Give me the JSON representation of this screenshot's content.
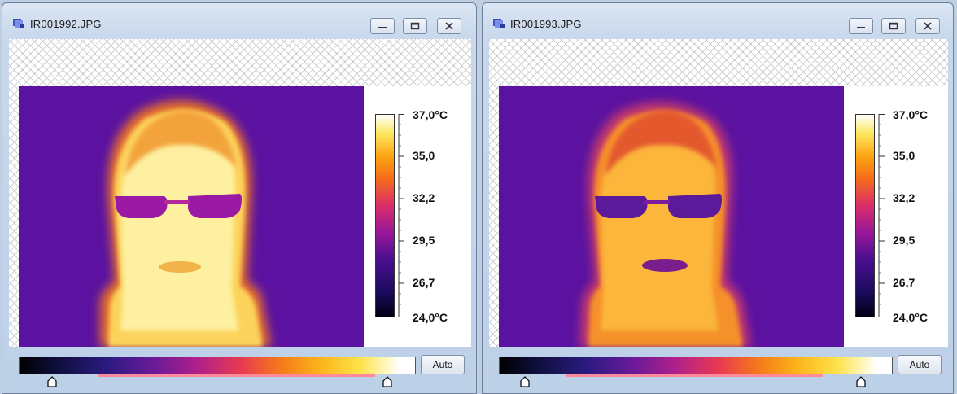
{
  "windows": [
    {
      "title": "IR001992.JPG",
      "scale": {
        "max_label": "37,0°C",
        "min_label": "24,0°C",
        "mid_labels": [
          "35,0",
          "32,2",
          "29,5",
          "26,7"
        ]
      },
      "auto_label": "Auto"
    },
    {
      "title": "IR001993.JPG",
      "scale": {
        "max_label": "37,0°C",
        "min_label": "24,0°C",
        "mid_labels": [
          "35,0",
          "32,2",
          "29,5",
          "26,7"
        ]
      },
      "auto_label": "Auto"
    }
  ],
  "icons": {
    "app": "thermal-image-icon",
    "minimize": "minimize-icon",
    "maximize": "maximize-icon",
    "close": "close-icon",
    "slider": "slider-handle-icon"
  },
  "colors": {
    "background_purple": "#5b12a0",
    "face_hot_left": "#fdf3a0",
    "face_hot_right": "#fcb43a"
  }
}
